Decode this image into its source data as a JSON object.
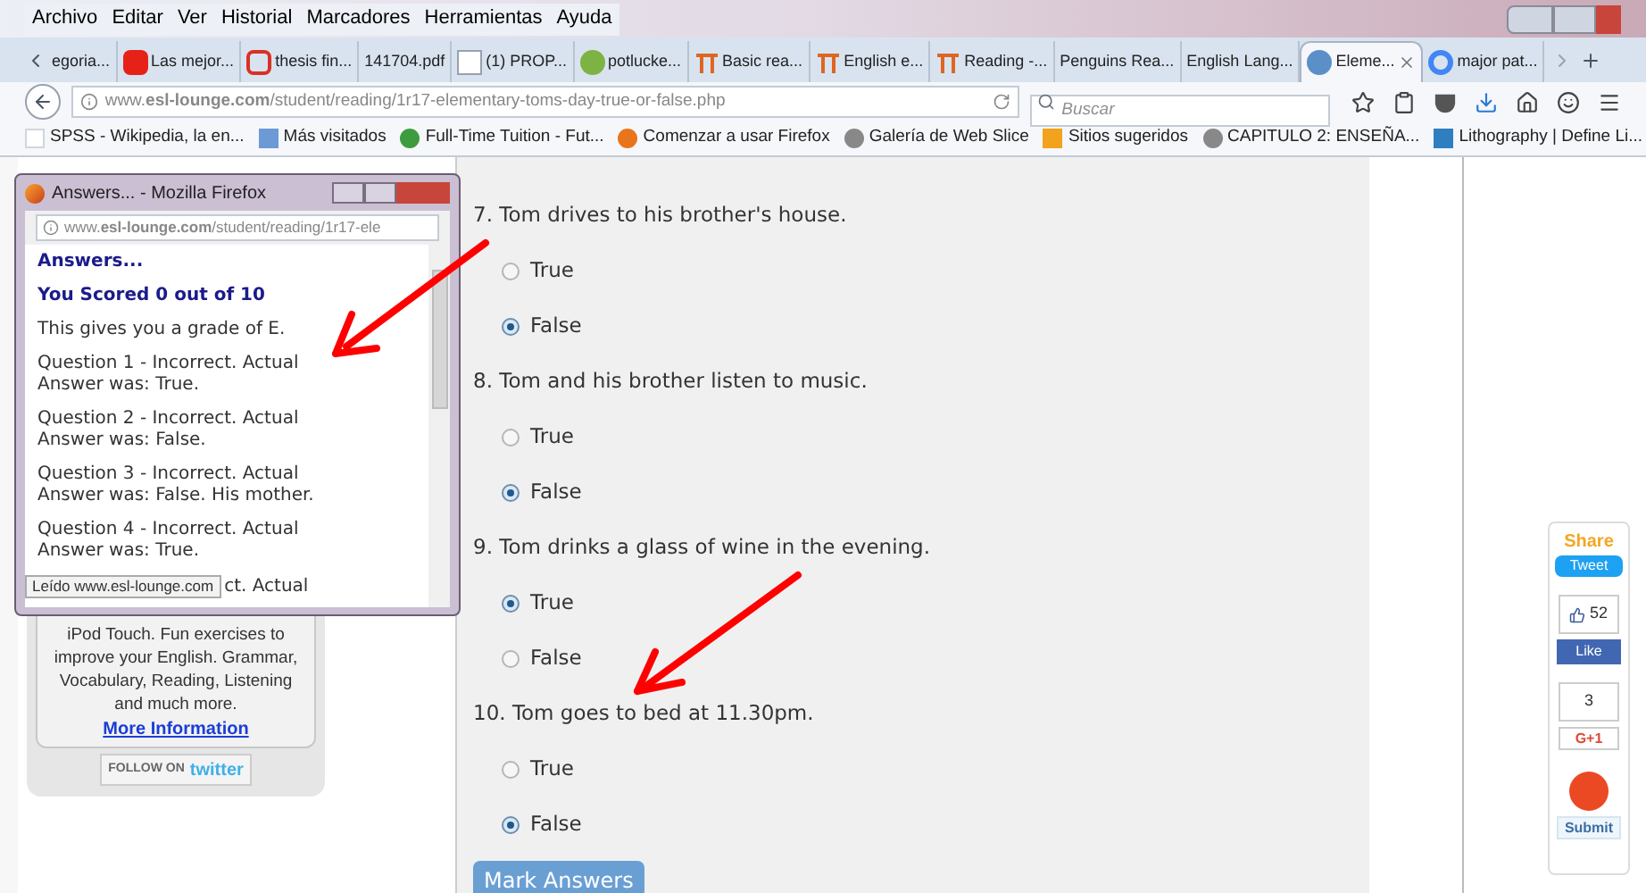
{
  "menu": [
    "Archivo",
    "Editar",
    "Ver",
    "Historial",
    "Marcadores",
    "Herramientas",
    "Ayuda"
  ],
  "tabs": [
    {
      "label": "egoria...",
      "selected": false
    },
    {
      "label": "Las mejor...",
      "selected": false
    },
    {
      "label": "thesis fin...",
      "selected": false
    },
    {
      "label": "141704.pdf",
      "selected": false
    },
    {
      "label": "(1) PROP...",
      "selected": false
    },
    {
      "label": "potlucke...",
      "selected": false
    },
    {
      "label": "Basic rea...",
      "selected": false
    },
    {
      "label": "English e...",
      "selected": false
    },
    {
      "label": "Reading -...",
      "selected": false
    },
    {
      "label": "Penguins Rea...",
      "selected": false
    },
    {
      "label": "English Lang...",
      "selected": false
    },
    {
      "label": "Eleme...",
      "selected": true
    },
    {
      "label": "major pat...",
      "selected": false
    }
  ],
  "address": {
    "url": "www.**esl-lounge.com**/student/reading/1r17-elementary-toms-day-true-or-false.php"
  },
  "search": {
    "placeholder": "Buscar"
  },
  "bookmarks": [
    "SPSS - Wikipedia, la en...",
    "Más visitados",
    "Full-Time Tuition - Fut...",
    "Comenzar a usar Firefox",
    "Galería de Web Slice",
    "Sitios sugeridos",
    "CAPITULO 2: ENSEÑA...",
    "Lithography | Define Li..."
  ],
  "sidebar": {
    "promo": "iPod Touch. Fun exercises to improve your English. Grammar, Vocabulary, Reading, Listening and much more.",
    "link": "More Information",
    "follow": "FOLLOW ON",
    "brand": "twitter"
  },
  "quiz": {
    "questions": [
      {
        "text": "7. Tom drives to his brother's house.",
        "options": [
          {
            "label": "True",
            "selected": false
          },
          {
            "label": "False",
            "selected": true
          }
        ]
      },
      {
        "text": "8. Tom and his brother listen to music.",
        "options": [
          {
            "label": "True",
            "selected": false
          },
          {
            "label": "False",
            "selected": true
          }
        ]
      },
      {
        "text": "9. Tom drinks a glass of wine in the evening.",
        "options": [
          {
            "label": "True",
            "selected": true
          },
          {
            "label": "False",
            "selected": false
          }
        ]
      },
      {
        "text": "10. Tom goes to bed at 11.30pm.",
        "options": [
          {
            "label": "True",
            "selected": false
          },
          {
            "label": "False",
            "selected": true
          }
        ]
      }
    ],
    "submit": "Mark Answers"
  },
  "popup": {
    "title": "Answers... - Mozilla Firefox",
    "url": "www.**esl-lounge.com**/student/reading/1r17-ele",
    "heading": "Answers...",
    "score": "You Scored 0 out of 10",
    "grade": "This gives you a grade of E.",
    "results": [
      "Question 1 - Incorrect. Actual Answer was: True.",
      "Question 2 - Incorrect. Actual Answer was: False.",
      "Question 3 - Incorrect. Actual Answer was: False. His mother.",
      "Question 4 - Incorrect. Actual Answer was: True."
    ],
    "partial": "ct. Actual",
    "status": "Leído www.esl-lounge.com"
  },
  "share": {
    "title": "Share",
    "tweet": "Tweet",
    "like_count": "52",
    "like": "Like",
    "plus_count": "3",
    "plus": "G+1",
    "submit": "Submit"
  }
}
